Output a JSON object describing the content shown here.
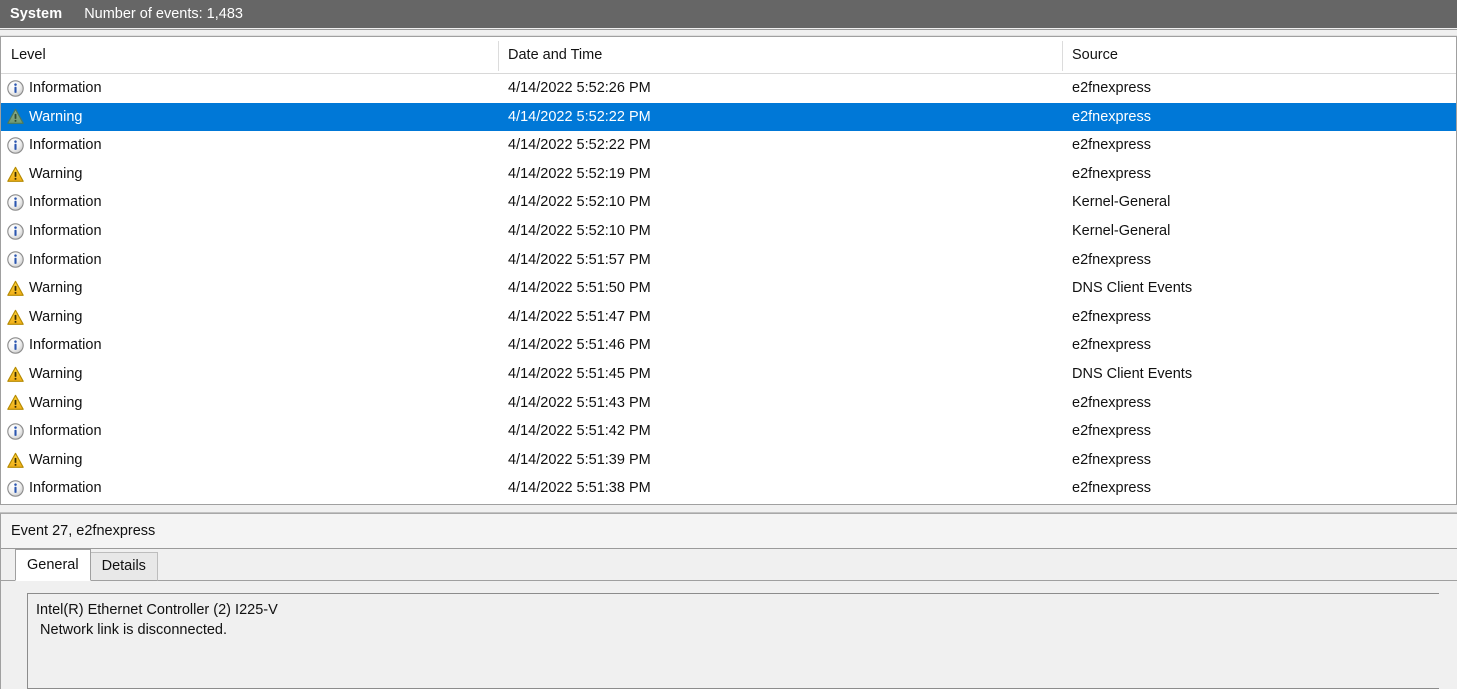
{
  "status_bar": {
    "log_name": "System",
    "event_count_label": "Number of events: 1,483",
    "background_color": "#666666"
  },
  "event_list": {
    "columns": [
      {
        "key": "level",
        "label": "Level"
      },
      {
        "key": "date",
        "label": "Date and Time"
      },
      {
        "key": "source",
        "label": "Source"
      }
    ],
    "selection_color": "#0078d7",
    "selected_index": 1,
    "rows": [
      {
        "level": "Information",
        "icon": "information-icon",
        "date": "4/14/2022 5:52:26 PM",
        "source": "e2fnexpress",
        "selected": false
      },
      {
        "level": "Warning",
        "icon": "warning-icon",
        "date": "4/14/2022 5:52:22 PM",
        "source": "e2fnexpress",
        "selected": true
      },
      {
        "level": "Information",
        "icon": "information-icon",
        "date": "4/14/2022 5:52:22 PM",
        "source": "e2fnexpress",
        "selected": false
      },
      {
        "level": "Warning",
        "icon": "warning-icon",
        "date": "4/14/2022 5:52:19 PM",
        "source": "e2fnexpress",
        "selected": false
      },
      {
        "level": "Information",
        "icon": "information-icon",
        "date": "4/14/2022 5:52:10 PM",
        "source": "Kernel-General",
        "selected": false
      },
      {
        "level": "Information",
        "icon": "information-icon",
        "date": "4/14/2022 5:52:10 PM",
        "source": "Kernel-General",
        "selected": false
      },
      {
        "level": "Information",
        "icon": "information-icon",
        "date": "4/14/2022 5:51:57 PM",
        "source": "e2fnexpress",
        "selected": false
      },
      {
        "level": "Warning",
        "icon": "warning-icon",
        "date": "4/14/2022 5:51:50 PM",
        "source": "DNS Client Events",
        "selected": false
      },
      {
        "level": "Warning",
        "icon": "warning-icon",
        "date": "4/14/2022 5:51:47 PM",
        "source": "e2fnexpress",
        "selected": false
      },
      {
        "level": "Information",
        "icon": "information-icon",
        "date": "4/14/2022 5:51:46 PM",
        "source": "e2fnexpress",
        "selected": false
      },
      {
        "level": "Warning",
        "icon": "warning-icon",
        "date": "4/14/2022 5:51:45 PM",
        "source": "DNS Client Events",
        "selected": false
      },
      {
        "level": "Warning",
        "icon": "warning-icon",
        "date": "4/14/2022 5:51:43 PM",
        "source": "e2fnexpress",
        "selected": false
      },
      {
        "level": "Information",
        "icon": "information-icon",
        "date": "4/14/2022 5:51:42 PM",
        "source": "e2fnexpress",
        "selected": false
      },
      {
        "level": "Warning",
        "icon": "warning-icon",
        "date": "4/14/2022 5:51:39 PM",
        "source": "e2fnexpress",
        "selected": false
      },
      {
        "level": "Information",
        "icon": "information-icon",
        "date": "4/14/2022 5:51:38 PM",
        "source": "e2fnexpress",
        "selected": false
      }
    ]
  },
  "detail_pane": {
    "title": "Event 27, e2fnexpress",
    "tabs": [
      {
        "label": "General",
        "active": true
      },
      {
        "label": "Details",
        "active": false
      }
    ],
    "description_lines": [
      "Intel(R) Ethernet Controller (2) I225-V",
      " Network link is disconnected."
    ]
  }
}
